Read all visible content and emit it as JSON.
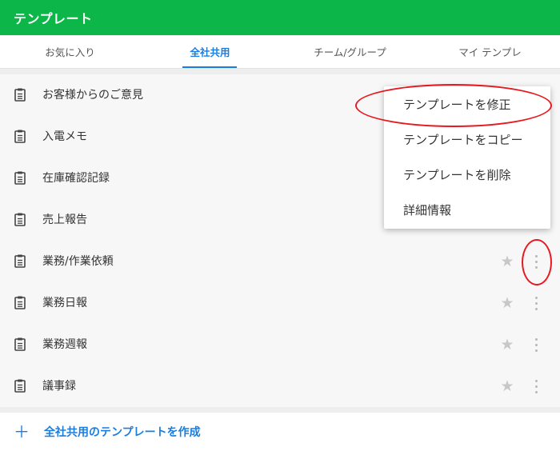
{
  "header": {
    "title": "テンプレート"
  },
  "tabs": [
    {
      "label": "お気に入り"
    },
    {
      "label": "全社共用"
    },
    {
      "label": "チーム/グループ"
    },
    {
      "label": "マイ テンプレ"
    }
  ],
  "active_tab": "全社共用",
  "templates": [
    {
      "name": "お客様からのご意見"
    },
    {
      "name": "入電メモ"
    },
    {
      "name": "在庫確認記録"
    },
    {
      "name": "売上報告"
    },
    {
      "name": "業務/作業依頼"
    },
    {
      "name": "業務日報"
    },
    {
      "name": "業務週報"
    },
    {
      "name": "議事録"
    }
  ],
  "row_icons": {
    "template": "clipboard-icon",
    "favorite": "star-icon",
    "more": "more-vertical-icon"
  },
  "context_menu": {
    "items": [
      {
        "label": "テンプレートを修正"
      },
      {
        "label": "テンプレートをコピー"
      },
      {
        "label": "テンプレートを削除"
      },
      {
        "label": "詳細情報"
      }
    ]
  },
  "footer": {
    "plus": "＋",
    "create_label": "全社共用のテンプレートを作成"
  },
  "colors": {
    "header": "#0cb648",
    "accent": "#1a7ee0",
    "highlight": "#e8181f"
  }
}
